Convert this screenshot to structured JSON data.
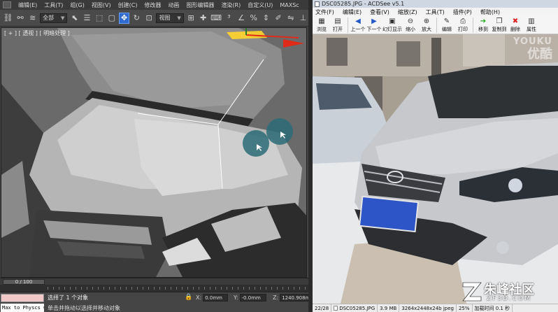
{
  "max": {
    "menu": [
      "编辑(E)",
      "工具(T)",
      "组(G)",
      "视图(V)",
      "创建(C)",
      "修改器",
      "动画",
      "图形编辑器",
      "渲染(R)",
      "自定义(U)",
      "MAXSc"
    ],
    "toolbar": {
      "selection_filter": "全部",
      "ref_coord": "视图"
    },
    "viewport": {
      "label": "[ + ] [ 透视 ] [ 明暗处理 ]"
    },
    "time_slider": "0 / 100",
    "status": {
      "listener": "Max to Physcs C",
      "selected": "选择了 1 个对象",
      "prompt": "单击并拖动以选择并移动对象",
      "x_label": "X:",
      "x_value": "0.0mm",
      "y_label": "Y:",
      "y_value": "-0.0mm",
      "z_label": "Z:",
      "z_value": "1240.908m"
    }
  },
  "acdsee": {
    "title": "DSC05285.JPG - ACDSee v5.1",
    "menu": [
      "文件(F)",
      "编辑(E)",
      "查看(V)",
      "缩放(Z)",
      "工具(T)",
      "插件(P)",
      "帮助(H)"
    ],
    "toolbar": [
      {
        "label": "浏览",
        "icon": "browse-icon",
        "glyph": "▦",
        "color": ""
      },
      {
        "label": "打开",
        "icon": "open-folder-icon",
        "glyph": "▤",
        "color": ""
      },
      {
        "label": "上一个",
        "icon": "previous-icon",
        "glyph": "◀",
        "color": "blue"
      },
      {
        "label": "下一个",
        "icon": "next-icon",
        "glyph": "▶",
        "color": "blue"
      },
      {
        "label": "幻灯显示",
        "icon": "slideshow-icon",
        "glyph": "▣",
        "color": ""
      },
      {
        "label": "缩小",
        "icon": "zoom-out-icon",
        "glyph": "⊖",
        "color": ""
      },
      {
        "label": "放大",
        "icon": "zoom-in-icon",
        "glyph": "⊕",
        "color": ""
      },
      {
        "label": "编辑",
        "icon": "edit-icon",
        "glyph": "✎",
        "color": ""
      },
      {
        "label": "打印",
        "icon": "print-icon",
        "glyph": "⎙",
        "color": ""
      },
      {
        "label": "移到",
        "icon": "move-to-icon",
        "glyph": "➔",
        "color": "green"
      },
      {
        "label": "复制到",
        "icon": "copy-to-icon",
        "glyph": "❐",
        "color": ""
      },
      {
        "label": "删除",
        "icon": "delete-icon",
        "glyph": "✖",
        "color": "red"
      },
      {
        "label": "属性",
        "icon": "properties-icon",
        "glyph": "▥",
        "color": ""
      }
    ],
    "status": {
      "index": "22/28",
      "filename": "DSC05285.JPG",
      "size": "3.9 MB",
      "dimensions": "3264x2448x24b jpeg",
      "zoom": "25%",
      "load_time": "加载时间 0.1 秒"
    }
  },
  "watermarks": {
    "youku_latin": "YOUKU",
    "youku_cn": "优酷",
    "zf_cn": "朱峰社区",
    "zf_en": "ZF3D.COM"
  },
  "colors": {
    "max_selected": "#2f6bd0",
    "arrow": "#e02a1a",
    "plate": "#2d55c8"
  }
}
